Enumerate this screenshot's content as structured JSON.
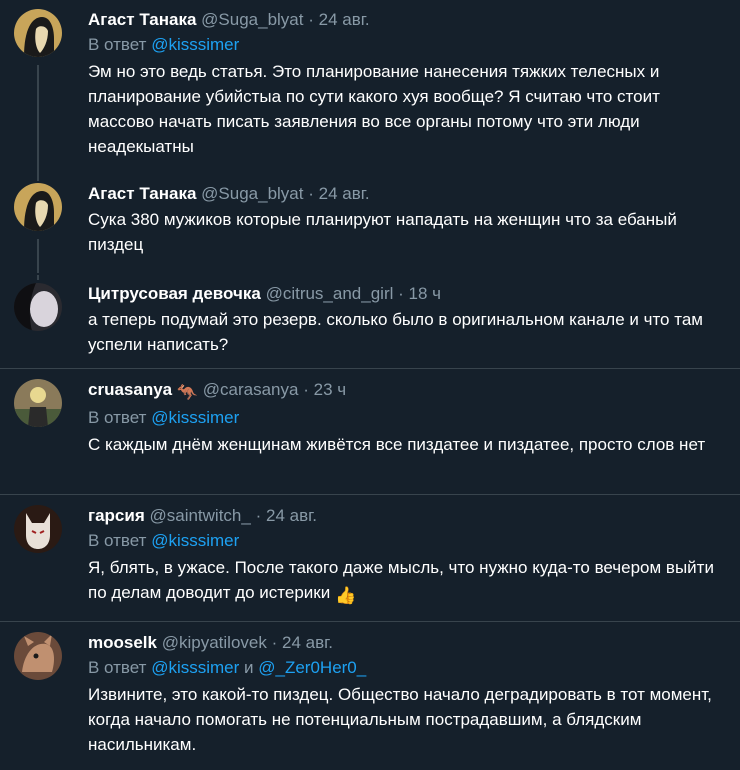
{
  "tweets": [
    {
      "name": "Агаст Танака",
      "handle": "@Suga_blyat",
      "time": "24 авг.",
      "reply_prefix": "В ответ",
      "reply_to": "@kisssimer",
      "text": "Эм но это ведь статья. Это планирование нанесения тяжких телесных и планирование убийстыа по сути какого хуя вообще? Я считаю что стоит массово начать писать заявления во все органы потому что эти люди неадекыатны"
    },
    {
      "name": "Агаст Танака",
      "handle": "@Suga_blyat",
      "time": "24 авг.",
      "text": "Сука 380 мужиков которые планируют нападать на женщин что за ебаный пиздец"
    },
    {
      "name": "Цитрусовая девочка",
      "handle": "@citrus_and_girl",
      "time": "18 ч",
      "text": "а теперь подумай это резерв. сколько было в оригинальном канале и что там успели написать?"
    },
    {
      "name": "cruasanya",
      "name_emoji": "🦘",
      "handle": "@carasanya",
      "time": "23 ч",
      "reply_prefix": "В ответ",
      "reply_to": "@kisssimer",
      "text": "С каждым днём женщинам живётся все пиздатее и пиздатее, просто слов нет"
    },
    {
      "name": "гарсия",
      "handle": "@saintwitch_",
      "time": "24 авг.",
      "reply_prefix": "В ответ",
      "reply_to": "@kisssimer",
      "text": "Я, блять, в ужасе. После такого даже мысль, что нужно куда-то вечером выйти по делам доводит до истерики",
      "text_emoji": "👍"
    },
    {
      "name": "mooselk",
      "handle": "@kipyatilovek",
      "time": "24 авг.",
      "reply_prefix": "В ответ",
      "reply_to": "@kisssimer",
      "reply_and": "и",
      "reply_to_2": "@_Zer0Her0_",
      "text": "Извините, это какой-то пиздец. Общество начало деградировать в тот момент, когда начало помогать не потенциальным пострадавшим, а блядским насильникам."
    }
  ],
  "separator": "·",
  "colors": {
    "background": "#15202b",
    "text": "#ffffff",
    "secondary": "#8899a6",
    "link": "#1da1f2",
    "divider": "#38444d"
  }
}
